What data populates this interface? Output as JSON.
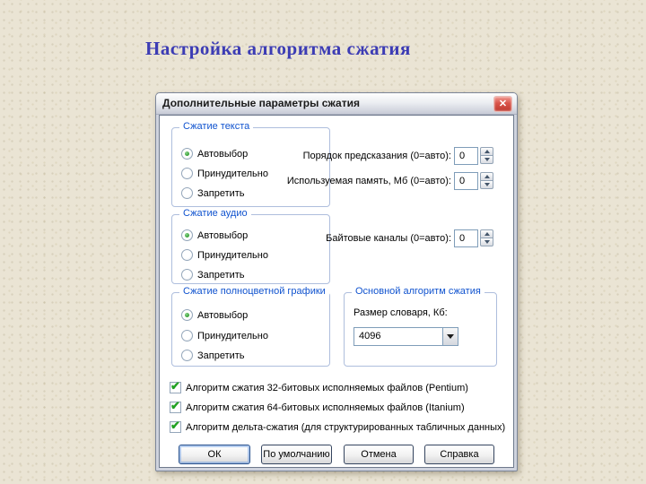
{
  "page": {
    "heading": "Настройка алгоритма сжатия"
  },
  "colors": {
    "background": "#eae4d4",
    "heading": "#3c3cb4",
    "group_label": "#1053cf",
    "check_green": "#21a121",
    "close_button_red": "#d9544a"
  },
  "dialog": {
    "title": "Дополнительные параметры сжатия",
    "close_glyph": "✕",
    "check_glyph": "✔",
    "groups": {
      "text": {
        "label": "Сжатие текста",
        "options": [
          "Автовыбор",
          "Принудительно",
          "Запретить"
        ],
        "selected": "Автовыбор"
      },
      "audio": {
        "label": "Сжатие аудио",
        "options": [
          "Автовыбор",
          "Принудительно",
          "Запретить"
        ],
        "selected": "Автовыбор"
      },
      "graphics": {
        "label": "Сжатие полноцветной графики",
        "options": [
          "Автовыбор",
          "Принудительно",
          "Запретить"
        ],
        "selected": "Автовыбор"
      },
      "main_algo": {
        "label": "Основной алгоритм сжатия",
        "dict_size_label": "Размер словаря, Кб:",
        "dict_size_value": "4096"
      }
    },
    "spin_fields": {
      "prediction_order": {
        "label": "Порядок предсказания (0=авто):",
        "value": "0"
      },
      "memory": {
        "label": "Используемая память, Мб (0=авто):",
        "value": "0"
      },
      "byte_channels": {
        "label": "Байтовые каналы (0=авто):",
        "value": "0"
      }
    },
    "checkboxes": [
      {
        "label": "Алгоритм сжатия 32-битовых исполняемых файлов (Pentium)",
        "checked": true
      },
      {
        "label": "Алгоритм сжатия 64-битовых исполняемых файлов (Itanium)",
        "checked": true
      },
      {
        "label": "Алгоритм дельта-сжатия (для структурированных табличных данных)",
        "checked": true
      }
    ],
    "buttons": {
      "ok": "ОК",
      "default": "По умолчанию",
      "cancel": "Отмена",
      "help": "Справка"
    }
  }
}
